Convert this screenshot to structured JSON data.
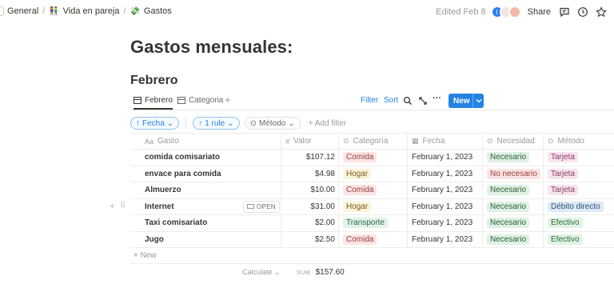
{
  "breadcrumb": {
    "items": [
      {
        "emoji": "",
        "label": "General"
      },
      {
        "emoji": "👫",
        "label": "Vida en pareja"
      },
      {
        "emoji": "💸",
        "label": "Gastos"
      }
    ],
    "separator": "/"
  },
  "topbar": {
    "edited": "Edited Feb 8",
    "avatar_initial": "I",
    "share_label": "Share"
  },
  "page": {
    "title": "Gastos mensuales:",
    "section": "Febrero"
  },
  "views": {
    "tabs": [
      {
        "label": "Febrero",
        "active": true
      },
      {
        "label": "Categoria",
        "active": false
      }
    ],
    "add_symbol": "+",
    "filter_label": "Filter",
    "sort_label": "Sort",
    "more_symbol": "···",
    "new_label": "New",
    "new_caret": "⌄"
  },
  "filters": {
    "chips": [
      {
        "icon": "↑",
        "label": "Fecha",
        "caret": "⌄"
      },
      {
        "icon": "↑",
        "label": "1 rule",
        "caret": "⌄"
      },
      {
        "icon": "⊙",
        "label": "Método",
        "caret": "⌄"
      }
    ],
    "add_filter": "+ Add filter"
  },
  "table": {
    "headers": [
      {
        "icon": "Aa",
        "label": "Gasto"
      },
      {
        "icon": "#",
        "label": "Valor"
      },
      {
        "icon": "⊙",
        "label": "Categoría"
      },
      {
        "icon": "▦",
        "label": "Fecha"
      },
      {
        "icon": "⊙",
        "label": "Necesidad"
      },
      {
        "icon": "⊙",
        "label": "Método"
      }
    ],
    "rows": [
      {
        "gasto": "comida comisariato",
        "valor": "$107.12",
        "categoria": "Comida",
        "fecha": "February 1, 2023",
        "necesidad": "Necesario",
        "metodo": "Tarjeta"
      },
      {
        "gasto": "envace para comida",
        "valor": "$4.98",
        "categoria": "Hogar",
        "fecha": "February 1, 2023",
        "necesidad": "No necesario",
        "metodo": "Tarjeta"
      },
      {
        "gasto": "Almuerzo",
        "valor": "$10.00",
        "categoria": "Comida",
        "fecha": "February 1, 2023",
        "necesidad": "Necesario",
        "metodo": "Tarjeta"
      },
      {
        "gasto": "Internet",
        "valor": "$31.00",
        "categoria": "Hogar",
        "fecha": "February 1, 2023",
        "necesidad": "Necesario",
        "metodo": "Débito directo"
      },
      {
        "gasto": "Taxi comisariato",
        "valor": "$2.00",
        "categoria": "Transporte",
        "fecha": "February 1, 2023",
        "necesidad": "Necesario",
        "metodo": "Efectivo"
      },
      {
        "gasto": "Jugo",
        "valor": "$2.50",
        "categoria": "Comida",
        "fecha": "February 1, 2023",
        "necesidad": "Necesario",
        "metodo": "Efectivo"
      }
    ],
    "open_label": "OPEN",
    "new_row": "+ New",
    "calculate_label": "Calculate ⌄",
    "sum_label": "SUM",
    "sum_value": "$157.60"
  },
  "tag_colors": {
    "Comida": {
      "bg": "#fbe4e4",
      "fg": "#93413b"
    },
    "Hogar": {
      "bg": "#fbf3db",
      "fg": "#7a5c1e"
    },
    "Transporte": {
      "bg": "#e2f3e8",
      "fg": "#2b6a46"
    },
    "Necesario": {
      "bg": "#dff1e4",
      "fg": "#2b5e3a"
    },
    "No necesario": {
      "bg": "#fbe4e4",
      "fg": "#93413b"
    },
    "Tarjeta": {
      "bg": "#f8e4ee",
      "fg": "#8c3966"
    },
    "Débito directo": {
      "bg": "#dde9f5",
      "fg": "#2a5378"
    },
    "Efectivo": {
      "bg": "#e2f3e5",
      "fg": "#2b6a3a"
    }
  },
  "colors": {
    "accent": "#2383e2",
    "text": "#37352f",
    "muted": "#9b9a97"
  }
}
